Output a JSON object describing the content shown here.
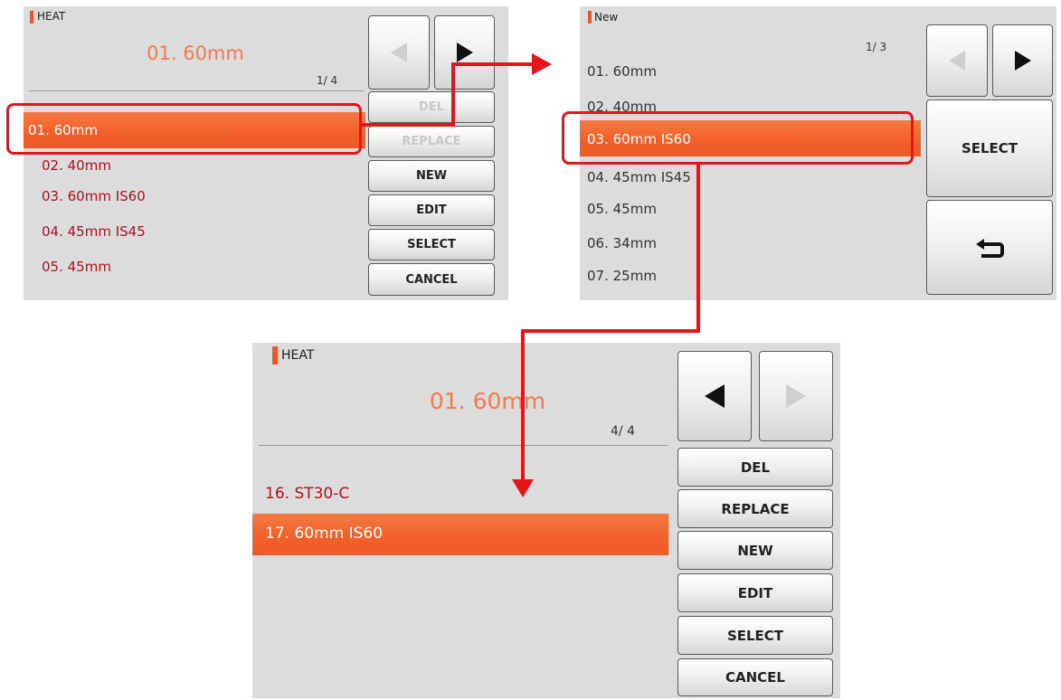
{
  "screen1": {
    "header": "HEAT",
    "title": "01. 60mm",
    "pager": "1/ 4",
    "items": [
      "01. 60mm",
      "02. 40mm",
      "03. 60mm IS60",
      "04. 45mm IS45",
      "05. 45mm"
    ],
    "buttons": {
      "del": "DEL",
      "replace": "REPLACE",
      "new": "NEW",
      "edit": "EDIT",
      "select": "SELECT",
      "cancel": "CANCEL"
    }
  },
  "screen2": {
    "header": "New",
    "pager": "1/ 3",
    "items": [
      "01. 60mm",
      "02. 40mm",
      "03. 60mm IS60",
      "04. 45mm IS45",
      "05. 45mm",
      "06. 34mm",
      "07. 25mm"
    ],
    "buttons": {
      "select": "SELECT"
    },
    "back_icon": "return-arrow-icon"
  },
  "screen3": {
    "header": "HEAT",
    "title": "01. 60mm",
    "pager": "4/ 4",
    "items": [
      "16. ST30-C",
      "17. 60mm IS60"
    ],
    "buttons": {
      "del": "DEL",
      "replace": "REPLACE",
      "new": "NEW",
      "edit": "EDIT",
      "select": "SELECT",
      "cancel": "CANCEL"
    }
  },
  "colors": {
    "accent": "#f0552a",
    "highlight": "#e8141c",
    "item_text": "#b01020",
    "panel": "#dcdcdc"
  }
}
